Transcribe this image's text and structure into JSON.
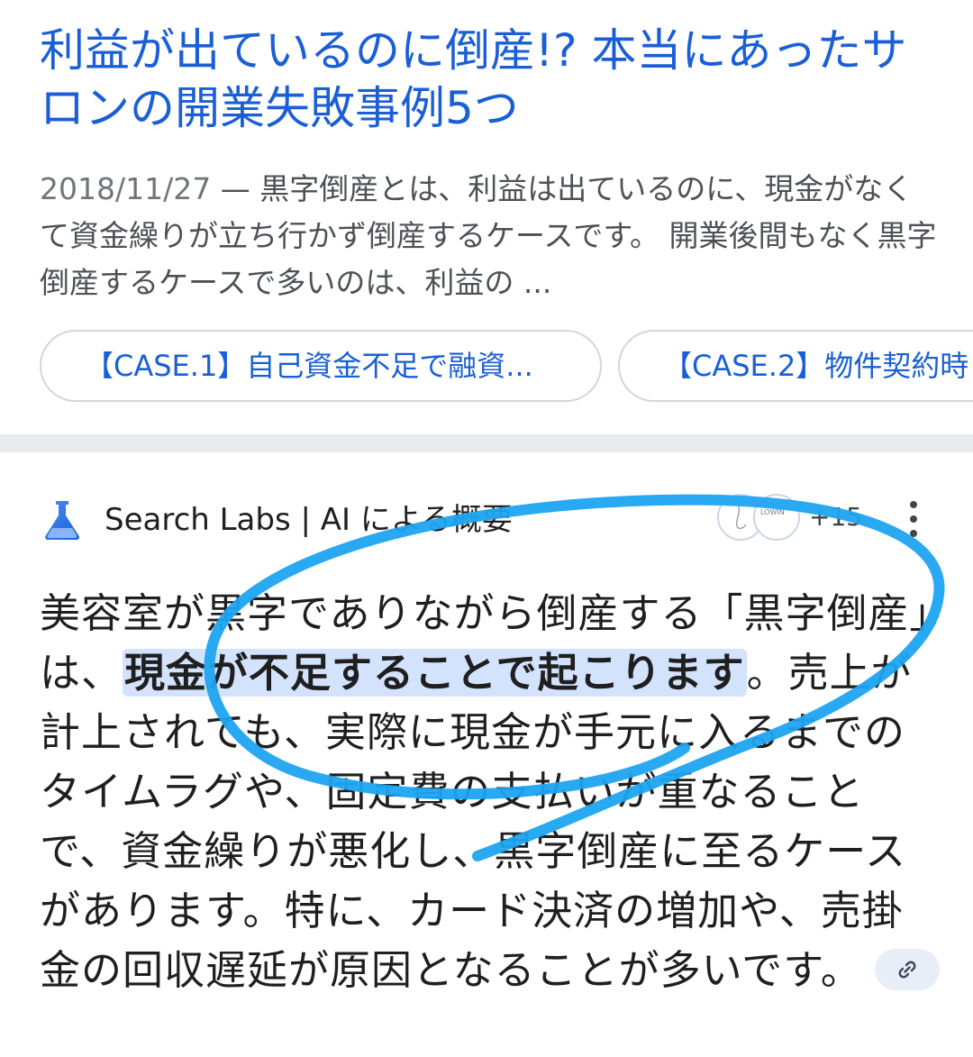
{
  "result": {
    "title": "利益が出ているのに倒産!? 本当にあったサロンの開業失敗事例5つ",
    "date": "2018/11/27",
    "separator": " — ",
    "snippet": "黒字倒産とは、利益は出ているのに、現金がなくて資金繰りが立ち行かず倒産するケースです。 開業後間もなく黒字倒産するケースで多いのは、利益の ...",
    "chips": [
      {
        "label": "【CASE.1】自己資金不足で融資..."
      },
      {
        "label": "【CASE.2】物件契約時"
      }
    ]
  },
  "ai_overview": {
    "brand": "Search Labs | AI による概要",
    "flask_icon": "flask-icon",
    "source_avatar_text": "LOWIN",
    "sources_more": "+15",
    "menu_icon": "more-vert-icon",
    "answer_before": "美容室が黒字でありながら倒産する「黒字倒産」は、",
    "answer_highlight": "現金が不足することで起こります",
    "answer_after": "。売上が計上されても、実際に現金が手元に入るまでのタイムラグや、固定費の支払いが重なることで、資金繰りが悪化し、黒字倒産に至るケースがあります。特に、カード決済の増加や、売掛金の回収遅延が原因となることが多いです。",
    "link_icon": "link-icon"
  },
  "colors": {
    "link_blue": "#1a5fd6",
    "highlight": "#d3e3fd",
    "annotation": "#1ea4f0",
    "divider": "#e8eaed"
  }
}
